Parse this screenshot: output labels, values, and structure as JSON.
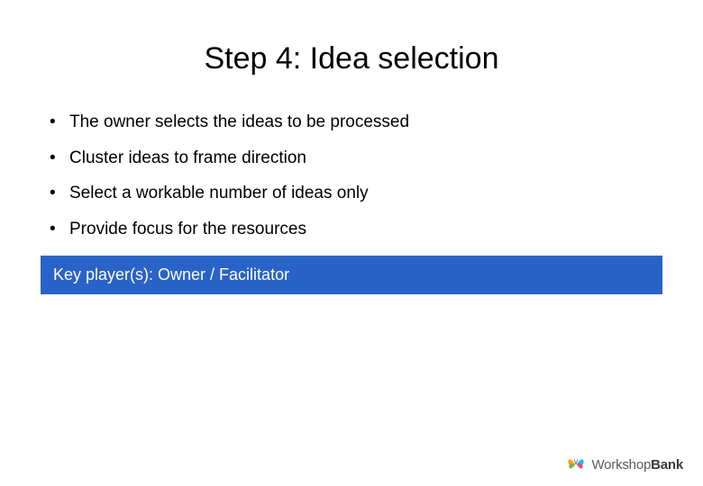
{
  "title": "Step 4: Idea selection",
  "bullets": [
    "The owner selects the ideas to be processed",
    "Cluster ideas to frame direction",
    "Select a workable number of ideas only",
    "Provide focus for the resources"
  ],
  "key_box": "Key player(s): Owner / Facilitator",
  "footer": {
    "brand_part1": "Workshop",
    "brand_part2": "Bank"
  }
}
